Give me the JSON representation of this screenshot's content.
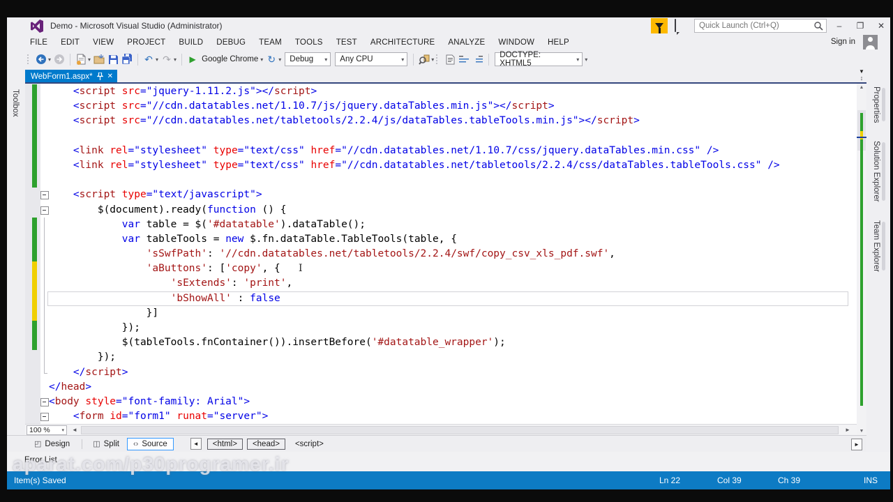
{
  "window": {
    "title": "Demo - Microsoft Visual Studio (Administrator)"
  },
  "title_bar": {
    "quick_launch_placeholder": "Quick Launch (Ctrl+Q)",
    "minimize": "–",
    "restore": "❐",
    "close": "✕"
  },
  "menu": {
    "items": [
      "FILE",
      "EDIT",
      "VIEW",
      "PROJECT",
      "BUILD",
      "DEBUG",
      "TEAM",
      "TOOLS",
      "TEST",
      "ARCHITECTURE",
      "ANALYZE",
      "WINDOW",
      "HELP"
    ],
    "sign_in": "Sign in"
  },
  "toolbar": {
    "start_label": "Google Chrome",
    "configuration": "Debug",
    "platform": "Any CPU",
    "doctype": "DOCTYPE: XHTML5"
  },
  "document_tabs": {
    "active_tab": "WebForm1.aspx*"
  },
  "left_rail": {
    "label": "Toolbox"
  },
  "right_rail": {
    "tabs": [
      "Properties",
      "Solution Explorer",
      "Team Explorer"
    ]
  },
  "editor": {
    "zoom_level": "100 %",
    "lines": [
      {
        "m": "g",
        "f": "none",
        "seg": [
          [
            "p",
            "    "
          ],
          [
            "k",
            "<"
          ],
          [
            "m",
            "script"
          ],
          [
            "p",
            " "
          ],
          [
            "r",
            "src"
          ],
          [
            "k",
            "=\"jquery-1.11.2.js\"></"
          ],
          [
            "m",
            "script"
          ],
          [
            "k",
            ">"
          ]
        ]
      },
      {
        "m": "g",
        "f": "none",
        "seg": [
          [
            "p",
            "    "
          ],
          [
            "k",
            "<"
          ],
          [
            "m",
            "script"
          ],
          [
            "p",
            " "
          ],
          [
            "r",
            "src"
          ],
          [
            "k",
            "=\"//cdn.datatables.net/1.10.7/js/jquery.dataTables.min.js\"></"
          ],
          [
            "m",
            "script"
          ],
          [
            "k",
            ">"
          ]
        ]
      },
      {
        "m": "g",
        "f": "none",
        "seg": [
          [
            "p",
            "    "
          ],
          [
            "k",
            "<"
          ],
          [
            "m",
            "script"
          ],
          [
            "p",
            " "
          ],
          [
            "r",
            "src"
          ],
          [
            "k",
            "=\"//cdn.datatables.net/tabletools/2.2.4/js/dataTables.tableTools.min.js\"></"
          ],
          [
            "m",
            "script"
          ],
          [
            "k",
            ">"
          ]
        ]
      },
      {
        "m": "g",
        "f": "none",
        "seg": [
          [
            "p",
            ""
          ]
        ]
      },
      {
        "m": "g",
        "f": "none",
        "seg": [
          [
            "p",
            "    "
          ],
          [
            "k",
            "<"
          ],
          [
            "m",
            "link"
          ],
          [
            "p",
            " "
          ],
          [
            "r",
            "rel"
          ],
          [
            "k",
            "=\"stylesheet\""
          ],
          [
            "p",
            " "
          ],
          [
            "r",
            "type"
          ],
          [
            "k",
            "=\"text/css\""
          ],
          [
            "p",
            " "
          ],
          [
            "r",
            "href"
          ],
          [
            "k",
            "=\"//cdn.datatables.net/1.10.7/css/jquery.dataTables.min.css\""
          ],
          [
            "p",
            " "
          ],
          [
            "k",
            "/>"
          ]
        ]
      },
      {
        "m": "g",
        "f": "none",
        "seg": [
          [
            "p",
            "    "
          ],
          [
            "k",
            "<"
          ],
          [
            "m",
            "link"
          ],
          [
            "p",
            " "
          ],
          [
            "r",
            "rel"
          ],
          [
            "k",
            "=\"stylesheet\""
          ],
          [
            "p",
            " "
          ],
          [
            "r",
            "type"
          ],
          [
            "k",
            "=\"text/css\""
          ],
          [
            "p",
            " "
          ],
          [
            "r",
            "href"
          ],
          [
            "k",
            "=\"//cdn.datatables.net/tabletools/2.2.4/css/dataTables.tableTools.css\""
          ],
          [
            "p",
            " "
          ],
          [
            "k",
            "/>"
          ]
        ]
      },
      {
        "m": "g",
        "f": "none",
        "seg": [
          [
            "p",
            ""
          ]
        ]
      },
      {
        "m": "",
        "f": "box",
        "seg": [
          [
            "p",
            "    "
          ],
          [
            "k",
            "<"
          ],
          [
            "m",
            "script"
          ],
          [
            "p",
            " "
          ],
          [
            "r",
            "type"
          ],
          [
            "k",
            "=\"text/javascript\">"
          ]
        ]
      },
      {
        "m": "",
        "f": "box",
        "seg": [
          [
            "p",
            "        $(document).ready("
          ],
          [
            "k",
            "function"
          ],
          [
            "p",
            " () {"
          ]
        ]
      },
      {
        "m": "g",
        "f": "line",
        "seg": [
          [
            "p",
            "            "
          ],
          [
            "k",
            "var"
          ],
          [
            "p",
            " table = $("
          ],
          [
            "m",
            "'#datatable'"
          ],
          [
            "p",
            ").dataTable();"
          ]
        ]
      },
      {
        "m": "g",
        "f": "line",
        "seg": [
          [
            "p",
            "            "
          ],
          [
            "k",
            "var"
          ],
          [
            "p",
            " tableTools = "
          ],
          [
            "k",
            "new"
          ],
          [
            "p",
            " $.fn.dataTable.TableTools(table, {"
          ]
        ]
      },
      {
        "m": "g",
        "f": "line",
        "seg": [
          [
            "p",
            "                "
          ],
          [
            "m",
            "'sSwfPath'"
          ],
          [
            "p",
            ": "
          ],
          [
            "m",
            "'//cdn.datatables.net/tabletools/2.2.4/swf/copy_csv_xls_pdf.swf'"
          ],
          [
            "p",
            ","
          ]
        ]
      },
      {
        "m": "y",
        "f": "line",
        "caret": true,
        "seg": [
          [
            "p",
            "                "
          ],
          [
            "m",
            "'aButtons'"
          ],
          [
            "p",
            ": ["
          ],
          [
            "m",
            "'copy'"
          ],
          [
            "p",
            ", {   "
          ]
        ]
      },
      {
        "m": "y",
        "f": "line",
        "seg": [
          [
            "p",
            "                    "
          ],
          [
            "m",
            "'sExtends'"
          ],
          [
            "p",
            ": "
          ],
          [
            "m",
            "'print'"
          ],
          [
            "p",
            ","
          ]
        ]
      },
      {
        "m": "y",
        "f": "line",
        "box": true,
        "seg": [
          [
            "p",
            "                    "
          ],
          [
            "m",
            "'bShowAll'"
          ],
          [
            "p",
            " : "
          ],
          [
            "k",
            "false"
          ]
        ]
      },
      {
        "m": "y",
        "f": "line",
        "seg": [
          [
            "p",
            "                }]"
          ]
        ]
      },
      {
        "m": "g",
        "f": "line",
        "seg": [
          [
            "p",
            "            });"
          ]
        ]
      },
      {
        "m": "g",
        "f": "line",
        "seg": [
          [
            "p",
            "            $(tableTools.fnContainer()).insertBefore("
          ],
          [
            "m",
            "'#datatable_wrapper'"
          ],
          [
            "p",
            ");"
          ]
        ]
      },
      {
        "m": "",
        "f": "line",
        "seg": [
          [
            "p",
            "        });"
          ]
        ]
      },
      {
        "m": "",
        "f": "end",
        "seg": [
          [
            "p",
            "    "
          ],
          [
            "k",
            "</"
          ],
          [
            "m",
            "script"
          ],
          [
            "k",
            ">"
          ]
        ]
      },
      {
        "m": "",
        "f": "none",
        "seg": [
          [
            "k",
            "</"
          ],
          [
            "m",
            "head"
          ],
          [
            "k",
            ">"
          ]
        ]
      },
      {
        "m": "",
        "f": "box",
        "seg": [
          [
            "k",
            "<"
          ],
          [
            "m",
            "body"
          ],
          [
            "p",
            " "
          ],
          [
            "r",
            "style"
          ],
          [
            "k",
            "=\"font-family: Arial\">"
          ]
        ]
      },
      {
        "m": "",
        "f": "box",
        "seg": [
          [
            "p",
            "    "
          ],
          [
            "k",
            "<"
          ],
          [
            "m",
            "form"
          ],
          [
            "p",
            " "
          ],
          [
            "r",
            "id"
          ],
          [
            "k",
            "=\"form1\""
          ],
          [
            "p",
            " "
          ],
          [
            "r",
            "runat"
          ],
          [
            "k",
            "=\"server\">"
          ]
        ]
      }
    ]
  },
  "view_bar": {
    "design": "Design",
    "split": "Split",
    "source": "Source",
    "crumbs": [
      "<html>",
      "<head>",
      "<script>"
    ]
  },
  "error_list_label": "Error List",
  "status_bar": {
    "message": "Item(s) Saved",
    "line": "Ln 22",
    "column": "Col 39",
    "character": "Ch 39",
    "mode": "INS"
  },
  "watermark": "aparat.com/p30programer.ir",
  "colors": {
    "accent_blue": "#007acc",
    "status_blue": "#0d7bc4",
    "change_green": "#2ea12e",
    "change_yellow": "#f0cf00",
    "code_keyword": "#0000e6",
    "code_string": "#a31515",
    "code_attribute": "#e80000",
    "feedback_yellow": "#fdb900",
    "logo_purple": "#68217a"
  }
}
